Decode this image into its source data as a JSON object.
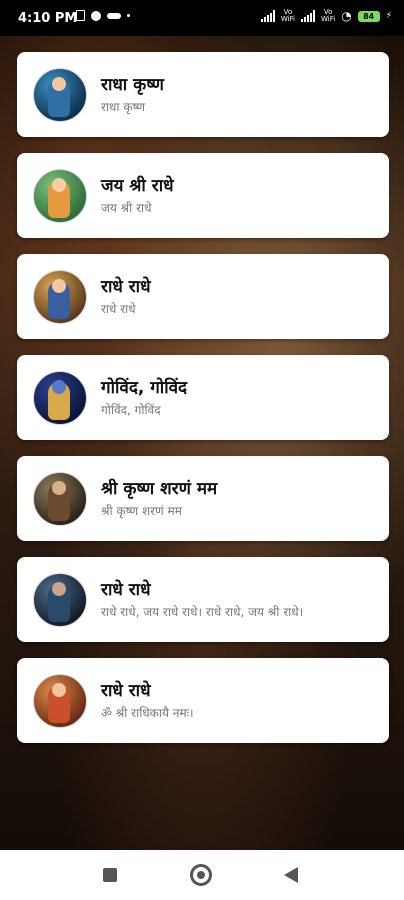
{
  "status_bar": {
    "time": "4:10 PM",
    "left_icons": [
      "sim-card-icon",
      "whatsapp-icon",
      "voicemail-icon",
      "dot-icon"
    ],
    "volte_1": "Vo\nWiFi",
    "volte_2": "Vo\nWiFi",
    "battery": "84"
  },
  "items": [
    {
      "title": "राधा कृष्ण",
      "subtitle": "राधा कृष्ण",
      "colors": [
        "#3a8fbf",
        "#0e2f4d",
        "#2f6fa3",
        "#f1c7a0"
      ]
    },
    {
      "title": "जय श्री राधे",
      "subtitle": "जय श्री राधे",
      "colors": [
        "#7bc17a",
        "#2d6d3a",
        "#e59a3f",
        "#f4cfa8"
      ]
    },
    {
      "title": "राधे राधे",
      "subtitle": "राधे राधे",
      "colors": [
        "#d9a44f",
        "#5b3a1e",
        "#3a5fa0",
        "#f0c7a2"
      ]
    },
    {
      "title": "गोविंद, गोविंद",
      "subtitle": "गोविंद, गोविंद",
      "colors": [
        "#2c3f8f",
        "#0b1637",
        "#d8a94a",
        "#5a78c8"
      ]
    },
    {
      "title": "श्री कृष्ण शरणं मम",
      "subtitle": "श्री कृष्ण शरणं मम",
      "colors": [
        "#8a7a5a",
        "#2a2418",
        "#6b4a2f",
        "#d9b08a"
      ]
    },
    {
      "title": "राधे राधे",
      "subtitle": "राधे राधे, जय राधे राधे। राधे राधे, जय श्री राधे।",
      "colors": [
        "#4a6a8a",
        "#121c28",
        "#2a4a6a",
        "#c9a488"
      ]
    },
    {
      "title": "राधे राधे",
      "subtitle": "ॐ श्री राधिकायै नमः।",
      "colors": [
        "#d98a4a",
        "#6a2a14",
        "#c8502a",
        "#f3c69a"
      ]
    }
  ]
}
